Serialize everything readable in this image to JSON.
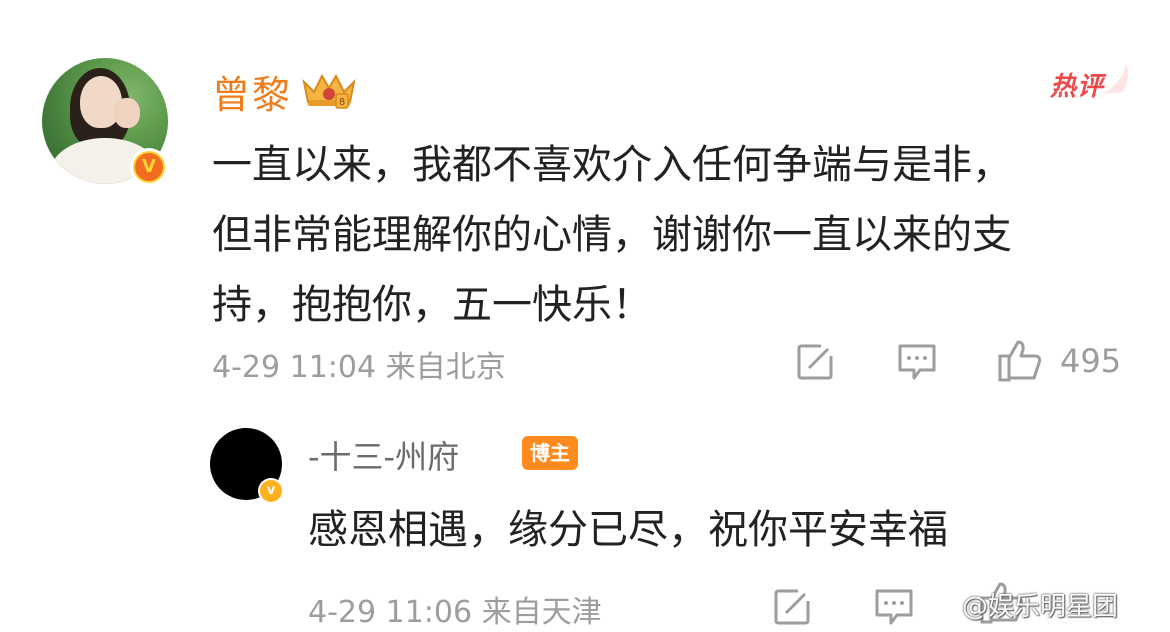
{
  "comment": {
    "author": "曾黎",
    "verified_badge": "V",
    "hot_tag": "热评",
    "lines": [
      "一直以来，我都不喜欢介入任何争端与是非，",
      "但非常能理解你的心情，谢谢你一直以来的支",
      "持，抱抱你，五一快乐！"
    ],
    "meta": "4-29 11:04 来自北京",
    "like_count": "495",
    "icons": {
      "share": "edit-share-icon",
      "comment": "comment-icon",
      "like": "thumbs-up-icon",
      "crown": "crown-badge-icon"
    }
  },
  "reply": {
    "author": "-十三-州府",
    "role_badge": "博主",
    "verified_badge": "v",
    "text": "感恩相遇，缘分已尽，祝你平安幸福",
    "meta": "4-29 11:06 来自天津"
  },
  "watermark": "@娱乐明星团",
  "colors": {
    "author_name": "#f07c1c",
    "hot_tag": "#ee4a4a",
    "meta_text": "#9d9d9d",
    "bozhu_badge": "#ff8a1e",
    "verified_orange": "#f26d1e"
  }
}
